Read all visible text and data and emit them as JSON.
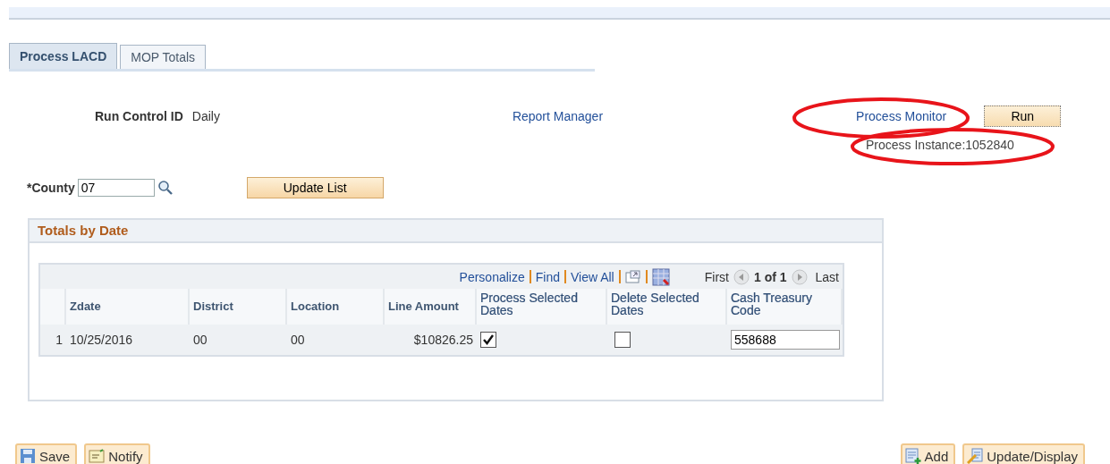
{
  "tabs": [
    {
      "label": "Process LACD",
      "selected": true
    },
    {
      "label": "MOP Totals",
      "selected": false
    }
  ],
  "run_control": {
    "label": "Run Control ID",
    "value": "Daily"
  },
  "report_manager": {
    "label": "Report Manager"
  },
  "process_monitor": {
    "label": "Process Monitor",
    "highlighted": true
  },
  "run_button": {
    "label": "Run"
  },
  "process_instance": {
    "text": "Process Instance:1052840",
    "highlighted": true
  },
  "county": {
    "label": "*County",
    "value": "07"
  },
  "update_list_button": {
    "label": "Update List"
  },
  "group": {
    "title": "Totals by Date",
    "grid": {
      "toolbar": {
        "links": [
          "Personalize",
          "Find",
          "View All"
        ],
        "first": "First",
        "range": "1 of 1",
        "last": "Last"
      },
      "columns": [
        "Zdate",
        "District",
        "Location",
        "Line Amount",
        "Process Selected Dates",
        "Delete Selected Dates",
        "Cash Treasury Code"
      ],
      "rows": [
        {
          "number": "1",
          "zdate": "10/25/2016",
          "district": "00",
          "location": "00",
          "line_amount": "$10826.25",
          "process_selected": true,
          "delete_selected": false,
          "cash_treasury_code": "558688"
        }
      ]
    }
  },
  "footer": {
    "left": [
      {
        "label": "Save",
        "kind": "save"
      },
      {
        "label": "Notify",
        "kind": "notify"
      }
    ],
    "right": [
      {
        "label": "Add",
        "kind": "add"
      },
      {
        "label": "Update/Display",
        "kind": "update"
      }
    ]
  }
}
